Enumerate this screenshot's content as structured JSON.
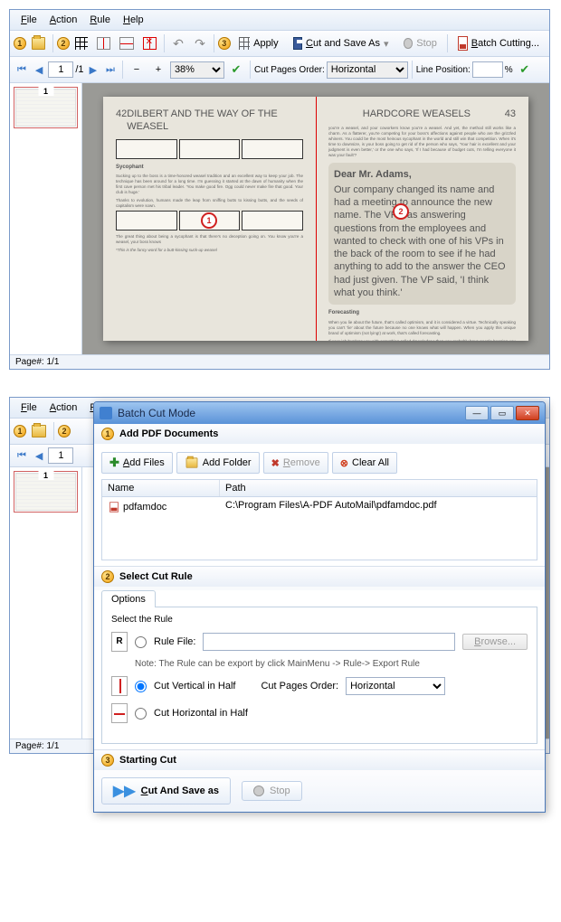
{
  "menu": {
    "file": "File",
    "action": "Action",
    "rule": "Rule",
    "help": "Help"
  },
  "toolbar": {
    "apply": "Apply",
    "cut_save": "Cut and Save As",
    "stop": "Stop",
    "batch": "Batch Cutting..."
  },
  "nav": {
    "page_cur": "1",
    "page_total": "/1",
    "zoom": "38%",
    "order_label": "Cut Pages Order:",
    "order_val": "Horizontal",
    "linepos": "Line Position:",
    "pct": "%"
  },
  "thumb": {
    "num": "1"
  },
  "status": {
    "page": "Page#: 1/1"
  },
  "book": {
    "left": {
      "num": "42",
      "header": "DILBERT AND THE WAY OF THE WEASEL",
      "sec1": "Sycophant",
      "p1": "Sucking up to the boss is a time-honored weasel tradition and an excellent way to keep your job. The technique has been around for a long time. I'm guessing it started at the dawn of humanity when the first cave person met his tribal leader. 'You make good fire. Ogg could never make fire that good. Your club is huge.'",
      "p2": "Thanks to evolution, humans made the leap from sniffing butts to kissing butts, and the seeds of capitalism were sown.",
      "p3": "The great thing about being a sycophant is that there's no deception going on. You know you're a weasel, your boss knows",
      "p4": "*This is the fancy word for a butt-kissing suck-up weasel"
    },
    "right": {
      "num": "43",
      "header": "Hardcore Weasels",
      "r1": "you're a weasel, and your coworkers know you're a weasel. And yet, the method still works like a charm. As a flatterer, you're competing for your boss's affections against people who are the grizzled whiners. You could be the most heinous sycophant in the world and still win that competition. When it's time to downsize, is your boss going to get rid of the person who says, 'Your hair is excellent and your judgment is even better,' or the one who says, 'If I had because of budget cuts, I'm telling everyone it was your fault'?",
      "cname": "Dear Mr. Adams,",
      "cbody": "Our company changed its name and had a meeting to announce the new name. The VP was answering questions from the employees and wanted to check with one of his VPs in the back of the room to see if he had anything to add to the answer the CEO had just given. The VP said, 'I think what you think.'",
      "sec2": "Forecasting",
      "r2": "When you lie about the future, that's called optimism, and it is considered a virtue. Technically speaking you can't 'lie' about the future because no one knows what will happen. When you apply this unique brand of optimism (not lying!) at work, that's called forecasting.",
      "r3": "If your job burdens you with something called 'knowledge,' then you probably have people begging you to predict the future of sales or expenses or market share or employee injuries or"
    },
    "marker1": "1",
    "marker2": "2"
  },
  "dialog": {
    "title": "Batch Cut Mode",
    "sec1": "Add PDF Documents",
    "addfiles": "Add Files",
    "addfolder": "Add Folder",
    "remove": "Remove",
    "clearall": "Clear All",
    "col_name": "Name",
    "col_path": "Path",
    "file_name": "pdfamdoc",
    "file_path": "C:\\Program Files\\A-PDF AutoMail\\pdfamdoc.pdf",
    "sec2": "Select Cut Rule",
    "tab_opt": "Options",
    "sel_rule": "Select the Rule",
    "opt_rulefile": "Rule File:",
    "note": "Note: The Rule can be export by click MainMenu -> Rule-> Export Rule",
    "browse": "Browse...",
    "opt_v": "Cut Vertical in Half",
    "cpo": "Cut Pages Order:",
    "cpo_val": "Horizontal",
    "opt_h": "Cut Horizontal in Half",
    "sec3": "Starting Cut",
    "cutandsave": "Cut And Save as",
    "stop": "Stop",
    "step1": "1",
    "step2": "2",
    "step3": "3"
  }
}
